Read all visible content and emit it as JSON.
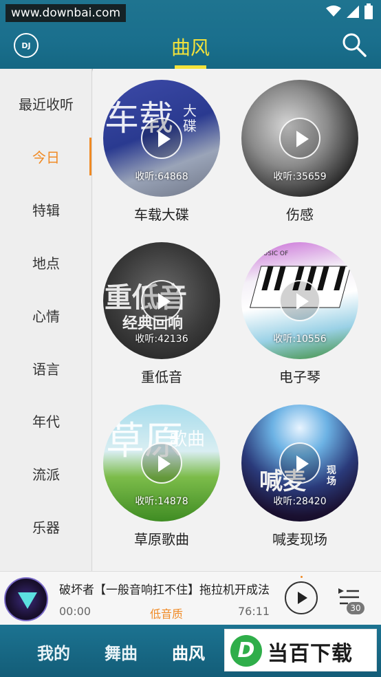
{
  "status": {
    "watermark": "www.downbai.com"
  },
  "header": {
    "logo_text": "DJ",
    "title": "曲风"
  },
  "sidebar": {
    "items": [
      {
        "label": "最近收听",
        "active": false
      },
      {
        "label": "今日",
        "active": true
      },
      {
        "label": "特辑",
        "active": false
      },
      {
        "label": "地点",
        "active": false
      },
      {
        "label": "心情",
        "active": false
      },
      {
        "label": "语言",
        "active": false
      },
      {
        "label": "年代",
        "active": false
      },
      {
        "label": "流派",
        "active": false
      },
      {
        "label": "乐器",
        "active": false
      }
    ]
  },
  "grid": {
    "items": [
      {
        "title": "车载大碟",
        "listens": "收听:64868",
        "cover_big": "车载",
        "cover_small": "大碟"
      },
      {
        "title": "伤感",
        "listens": "收听:35659"
      },
      {
        "title": "重低音",
        "listens": "收听:42136",
        "cover_big": "重低音",
        "cover_small": "经典回响"
      },
      {
        "title": "电子琴",
        "listens": "收听:10556",
        "cover_small": "MUSIC OF"
      },
      {
        "title": "草原歌曲",
        "listens": "收听:14878",
        "cover_big": "草原",
        "cover_small": "歌曲"
      },
      {
        "title": "喊麦现场",
        "listens": "收听:28420",
        "cover_big": "喊麦",
        "cover_small": "现场"
      }
    ]
  },
  "player": {
    "song_title": "破坏者【一般音响扛不住】拖拉机开成法",
    "time_start": "00:00",
    "quality": "低音质",
    "time_end": "76:11",
    "playlist_count": "30",
    "art_label": "V"
  },
  "bottom_nav": {
    "items": [
      {
        "label": "我的"
      },
      {
        "label": "舞曲"
      },
      {
        "label": "曲风"
      }
    ],
    "brand_letter": "D",
    "brand_text": "当百下载"
  },
  "colors": {
    "header": "#1a6f8d",
    "accent": "#f08a24",
    "title": "#f3e23a"
  }
}
